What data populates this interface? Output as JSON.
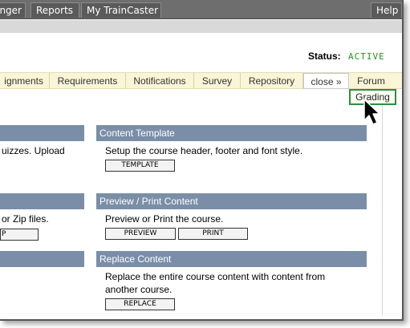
{
  "topnav": {
    "items": [
      "nger",
      "Reports",
      "My TrainCaster",
      "Help"
    ]
  },
  "status": {
    "label": "Status:",
    "value": "ACTIVE",
    "color": "#1b9b1b"
  },
  "tabs": [
    "ignments",
    "Requirements",
    "Notifications",
    "Survey",
    "Repository",
    "close »",
    "Forum"
  ],
  "dropdown": {
    "items": [
      "Grading"
    ]
  },
  "left_sections": {
    "s1_text": "uizzes. Upload",
    "s2_text": "or Zip files.",
    "s2_button": "P"
  },
  "right_sections": {
    "template": {
      "title": "Content Template",
      "description": "Setup the course header, footer and font style.",
      "button": "TEMPLATE"
    },
    "preview": {
      "title": "Preview / Print Content",
      "description": "Preview or Print the course.",
      "button_preview": "PREVIEW",
      "button_print": "PRINT"
    },
    "replace": {
      "title": "Replace Content",
      "description_line1": "Replace the entire course content with content from",
      "description_line2": "another course.",
      "button": "REPLACE"
    }
  },
  "colors": {
    "section_header": "#7a8ea8",
    "tab_strip": "#fbf5d7",
    "topnav": "#6e6e6e",
    "highlight_border": "#2b8f3d"
  }
}
